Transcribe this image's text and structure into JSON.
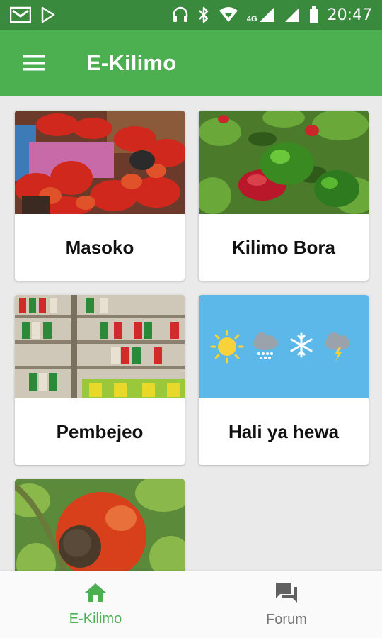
{
  "status_bar": {
    "time": "20:47",
    "network_label": "4G"
  },
  "app_bar": {
    "title": "E-Kilimo",
    "menu_icon": "hamburger-menu-icon"
  },
  "cards": [
    {
      "label": "Masoko",
      "image": "peppers-market-photo"
    },
    {
      "label": "Kilimo Bora",
      "image": "green-red-peppers-photo"
    },
    {
      "label": "Pembejeo",
      "image": "seed-packets-shelf-photo"
    },
    {
      "label": "Hali ya hewa",
      "image": "weather-icons-banner"
    },
    {
      "label": "",
      "image": "tomato-photo"
    }
  ],
  "bottom_nav": {
    "items": [
      {
        "label": "E-Kilimo",
        "icon": "home-icon",
        "active": true
      },
      {
        "label": "Forum",
        "icon": "forum-icon",
        "active": false
      }
    ]
  },
  "colors": {
    "primary": "#4caf50",
    "primary_dark": "#3a8a3e",
    "weather_bg": "#5bb8e8"
  }
}
